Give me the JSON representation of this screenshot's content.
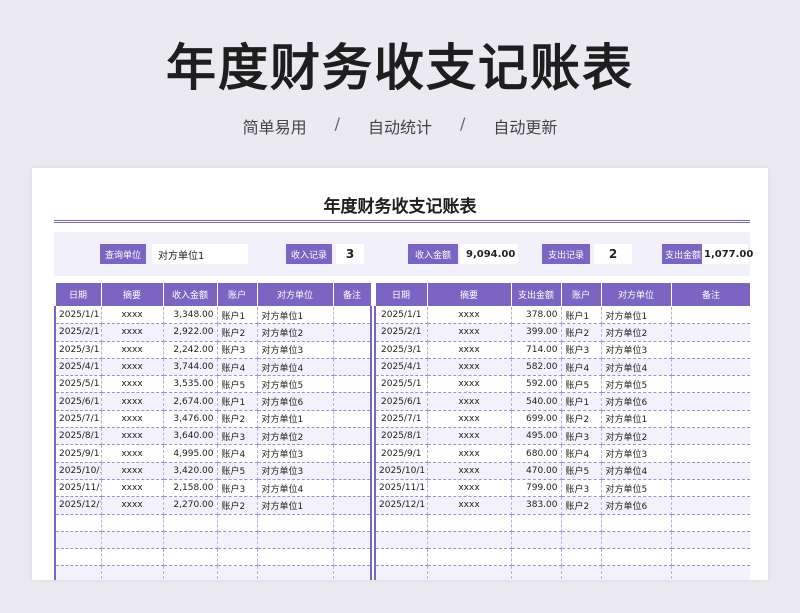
{
  "hero": {
    "title": "年度财务收支记账表",
    "tags": [
      "简单易用",
      "自动统计",
      "自动更新"
    ],
    "separator": "/"
  },
  "sheet": {
    "title": "年度财务收支记账表",
    "summary": {
      "query_label": "查询单位",
      "query_value": "对方单位1",
      "income_count_label": "收入记录",
      "income_count": "3",
      "income_total_label": "收入金额",
      "income_total": "9,094.00",
      "expense_count_label": "支出记录",
      "expense_count": "2",
      "expense_total_label": "支出金额",
      "expense_total": "1,077.00"
    },
    "income_table": {
      "headers": [
        "日期",
        "摘要",
        "收入金额",
        "账户",
        "对方单位",
        "备注"
      ],
      "rows": [
        [
          "2025/1/1",
          "xxxx",
          "3,348.00",
          "账户1",
          "对方单位1",
          ""
        ],
        [
          "2025/2/1",
          "xxxx",
          "2,922.00",
          "账户2",
          "对方单位2",
          ""
        ],
        [
          "2025/3/1",
          "xxxx",
          "2,242.00",
          "账户3",
          "对方单位3",
          ""
        ],
        [
          "2025/4/1",
          "xxxx",
          "3,744.00",
          "账户4",
          "对方单位4",
          ""
        ],
        [
          "2025/5/1",
          "xxxx",
          "3,535.00",
          "账户5",
          "对方单位5",
          ""
        ],
        [
          "2025/6/1",
          "xxxx",
          "2,674.00",
          "账户1",
          "对方单位6",
          ""
        ],
        [
          "2025/7/1",
          "xxxx",
          "3,476.00",
          "账户2",
          "对方单位1",
          ""
        ],
        [
          "2025/8/1",
          "xxxx",
          "3,640.00",
          "账户3",
          "对方单位2",
          ""
        ],
        [
          "2025/9/1",
          "xxxx",
          "4,995.00",
          "账户4",
          "对方单位3",
          ""
        ],
        [
          "2025/10/1",
          "xxxx",
          "3,420.00",
          "账户5",
          "对方单位3",
          ""
        ],
        [
          "2025/11/1",
          "xxxx",
          "2,158.00",
          "账户3",
          "对方单位4",
          ""
        ],
        [
          "2025/12/1",
          "xxxx",
          "2,270.00",
          "账户2",
          "对方单位1",
          ""
        ],
        [
          "",
          "",
          "",
          "",
          "",
          ""
        ],
        [
          "",
          "",
          "",
          "",
          "",
          ""
        ],
        [
          "",
          "",
          "",
          "",
          "",
          ""
        ],
        [
          "",
          "",
          "",
          "",
          "",
          ""
        ]
      ]
    },
    "expense_table": {
      "headers": [
        "日期",
        "摘要",
        "支出金额",
        "账户",
        "对方单位",
        "备注"
      ],
      "rows": [
        [
          "2025/1/1",
          "xxxx",
          "378.00",
          "账户1",
          "对方单位1",
          ""
        ],
        [
          "2025/2/1",
          "xxxx",
          "399.00",
          "账户2",
          "对方单位2",
          ""
        ],
        [
          "2025/3/1",
          "xxxx",
          "714.00",
          "账户3",
          "对方单位3",
          ""
        ],
        [
          "2025/4/1",
          "xxxx",
          "582.00",
          "账户4",
          "对方单位4",
          ""
        ],
        [
          "2025/5/1",
          "xxxx",
          "592.00",
          "账户5",
          "对方单位5",
          ""
        ],
        [
          "2025/6/1",
          "xxxx",
          "540.00",
          "账户1",
          "对方单位6",
          ""
        ],
        [
          "2025/7/1",
          "xxxx",
          "699.00",
          "账户2",
          "对方单位1",
          ""
        ],
        [
          "2025/8/1",
          "xxxx",
          "495.00",
          "账户3",
          "对方单位2",
          ""
        ],
        [
          "2025/9/1",
          "xxxx",
          "680.00",
          "账户4",
          "对方单位3",
          ""
        ],
        [
          "2025/10/1",
          "xxxx",
          "470.00",
          "账户5",
          "对方单位4",
          ""
        ],
        [
          "2025/11/1",
          "xxxx",
          "799.00",
          "账户3",
          "对方单位5",
          ""
        ],
        [
          "2025/12/1",
          "xxxx",
          "383.00",
          "账户2",
          "对方单位6",
          ""
        ],
        [
          "",
          "",
          "",
          "",
          "",
          ""
        ],
        [
          "",
          "",
          "",
          "",
          "",
          ""
        ],
        [
          "",
          "",
          "",
          "",
          "",
          ""
        ],
        [
          "",
          "",
          "",
          "",
          "",
          ""
        ]
      ]
    }
  },
  "colors": {
    "accent": "#7a66c2",
    "summary_bg": "#f1effa",
    "row_alt": "#f3f1fb",
    "page_bg": "#eceaf1"
  }
}
